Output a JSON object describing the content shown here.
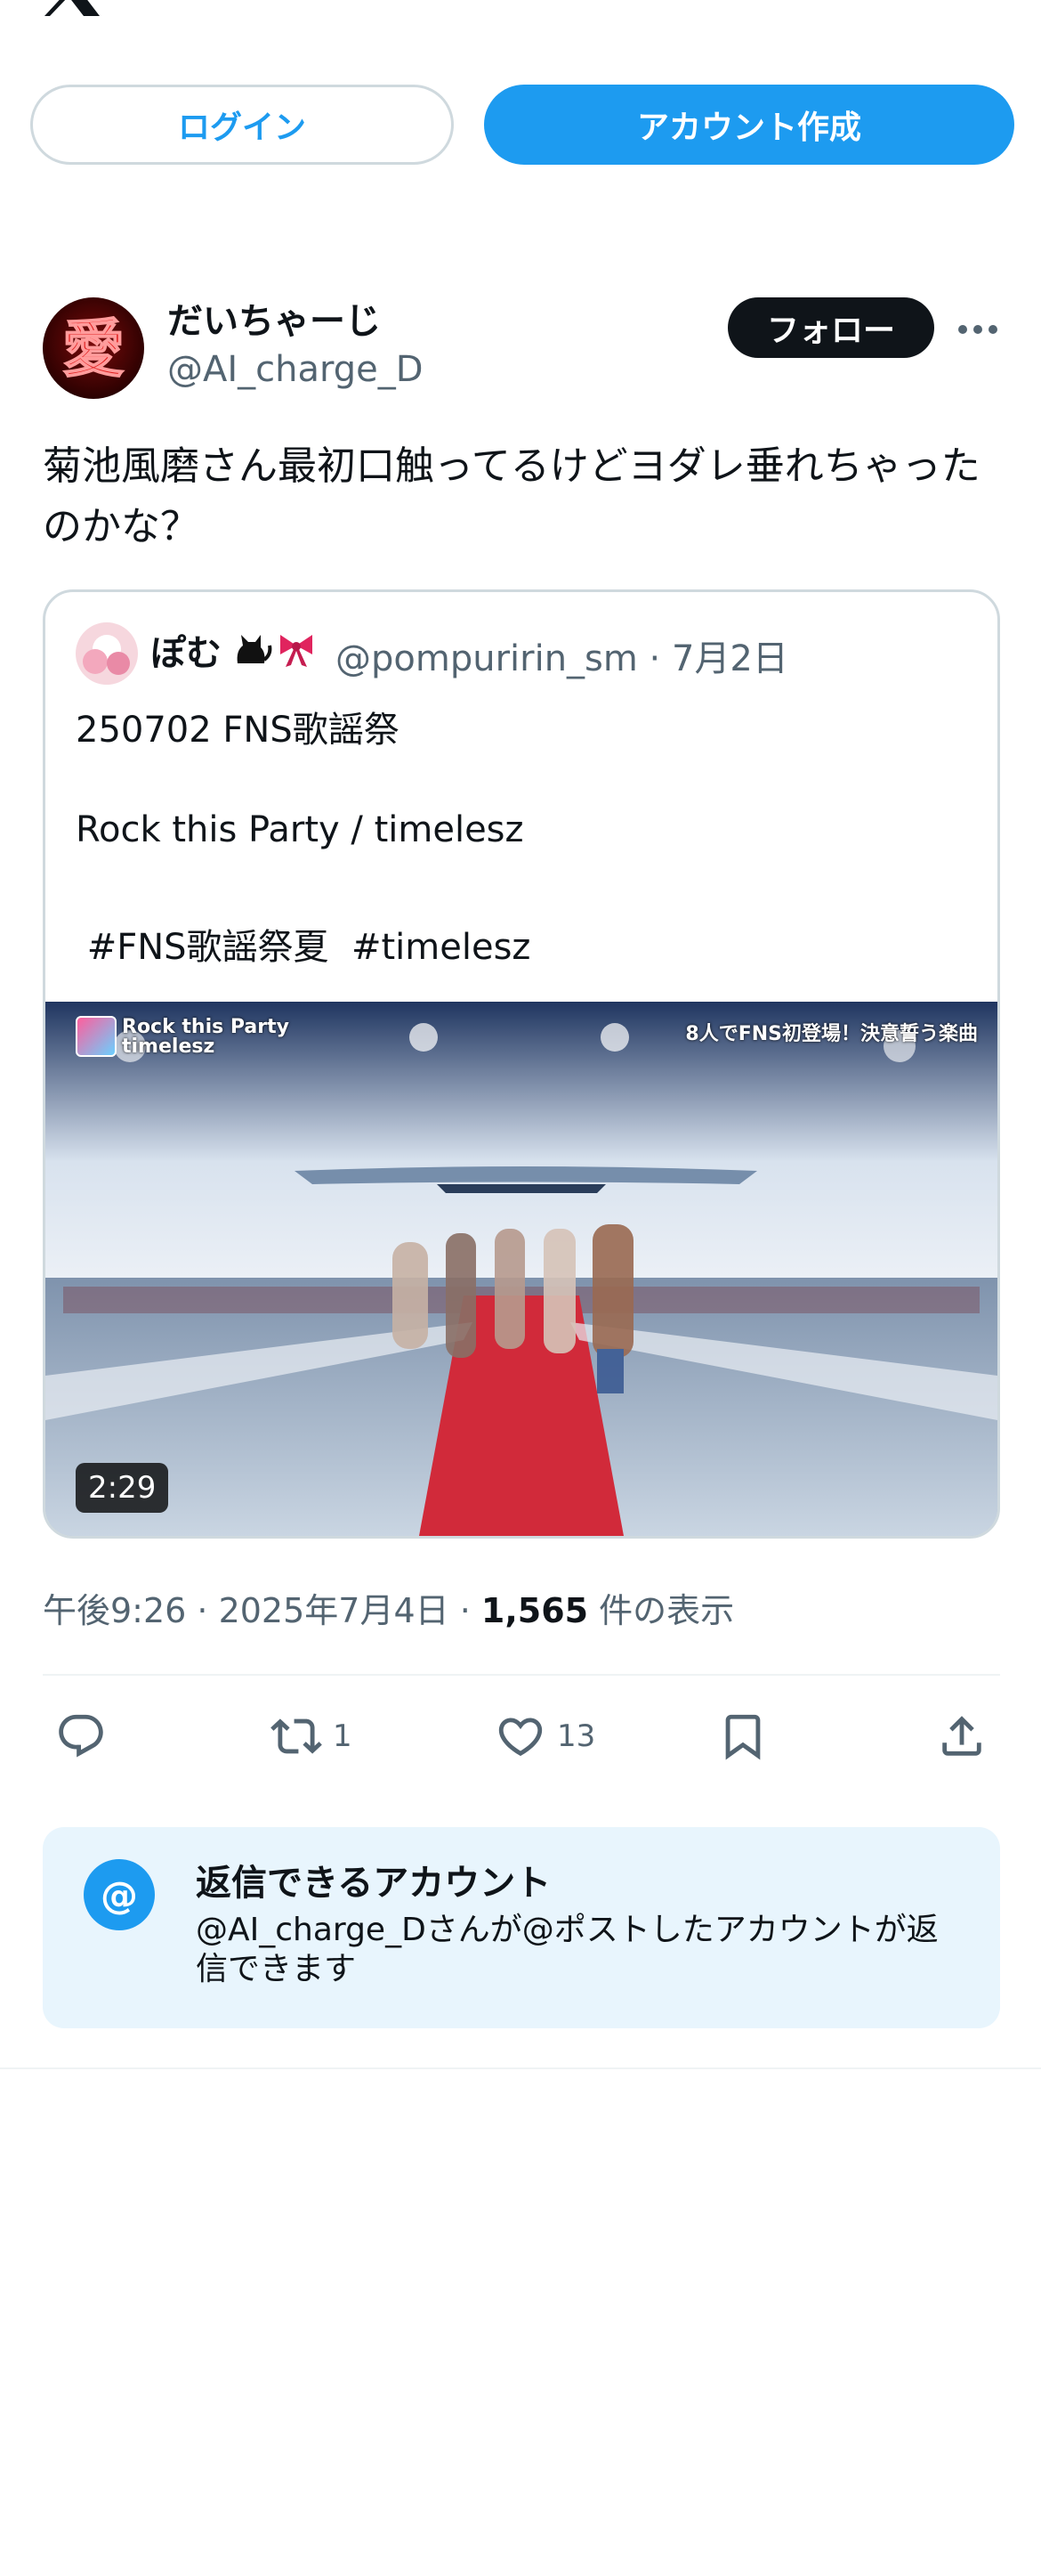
{
  "header": {
    "logo_icon": "x-logo-icon",
    "login_label": "ログイン",
    "signup_label": "アカウント作成"
  },
  "post": {
    "author": {
      "name": "だいちゃーじ",
      "handle": "@AI_charge_D",
      "avatar_icon": "avatar-kanji-ai"
    },
    "follow_label": "フォロー",
    "text": "菊池風磨さん最初口触ってるけどヨダレ垂れちゃったのかな？",
    "quoted": {
      "name": "ぽむ",
      "handle_date": "@pompuririn_sm · 7月2日",
      "lines": [
        "250702 FNS歌謡祭",
        "Rock this Party / timelesz",
        " #FNS歌謡祭夏  #timelesz"
      ],
      "video": {
        "duration": "2:29",
        "overlay_title_1": "Rock this Party",
        "overlay_title_2": "timelesz",
        "overlay_right": "8人でFNS初登場！決意誓う楽曲"
      }
    },
    "meta": {
      "time_date": "午後9:26 · 2025年7月4日 · ",
      "views": "1,565",
      "views_label": " 件の表示"
    },
    "actions": {
      "retweet_count": "1",
      "like_count": "13"
    },
    "reply_restriction": {
      "title": "返信できるアカウント",
      "text": "@AI_charge_Dさんが@ポストしたアカウントが返信できます",
      "icon_text": "@"
    }
  },
  "colors": {
    "accent": "#1d9bf0",
    "text": "#0f1419",
    "secondary": "#536471",
    "reply_box_bg": "#e8f5fd"
  }
}
